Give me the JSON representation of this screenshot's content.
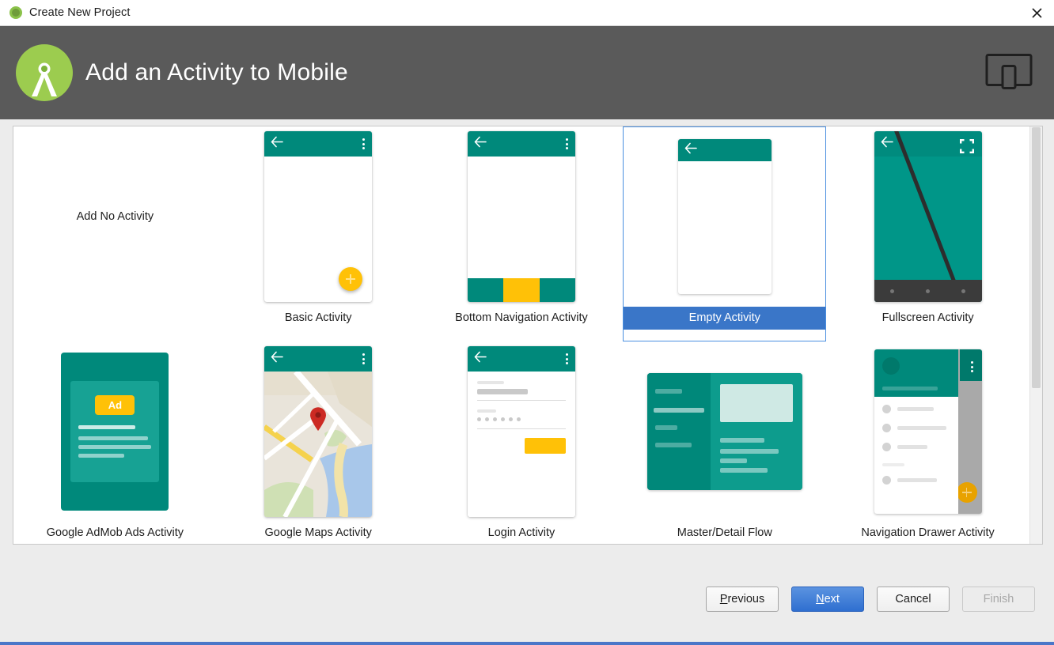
{
  "window": {
    "title": "Create New Project",
    "app_icon": "android-studio-icon",
    "close_icon": "close-icon"
  },
  "header": {
    "title": "Add an Activity to Mobile",
    "logo_icon": "android-studio-logo",
    "device_icon": "tablet-device-icon"
  },
  "gallery": {
    "no_activity_label": "Add No Activity",
    "items": [
      {
        "label": "Add No Activity",
        "kind": "none",
        "selected": false
      },
      {
        "label": "Basic Activity",
        "kind": "basic",
        "selected": false
      },
      {
        "label": "Bottom Navigation Activity",
        "kind": "bottom-nav",
        "selected": false
      },
      {
        "label": "Empty Activity",
        "kind": "empty",
        "selected": true
      },
      {
        "label": "Fullscreen Activity",
        "kind": "fullscreen",
        "selected": false
      },
      {
        "label": "Google AdMob Ads Activity",
        "kind": "admob",
        "selected": false
      },
      {
        "label": "Google Maps Activity",
        "kind": "maps",
        "selected": false
      },
      {
        "label": "Login Activity",
        "kind": "login",
        "selected": false
      },
      {
        "label": "Master/Detail Flow",
        "kind": "master-detail",
        "selected": false
      },
      {
        "label": "Navigation Drawer Activity",
        "kind": "nav-drawer",
        "selected": false
      }
    ],
    "admob_badge": "Ad"
  },
  "footer": {
    "previous": "Previous",
    "previous_mnemonic": "P",
    "previous_rest": "revious",
    "next": "Next",
    "next_mnemonic": "N",
    "next_rest": "ext",
    "cancel": "Cancel",
    "finish": "Finish"
  },
  "colors": {
    "header_bg": "#5a5a5a",
    "accent_teal": "#00897b",
    "accent_amber": "#ffc107",
    "selection_blue": "#3a76c8",
    "selection_border": "#4a8fe0",
    "footer_accent": "#4a76c8",
    "logo_green": "#9ccc4f"
  }
}
